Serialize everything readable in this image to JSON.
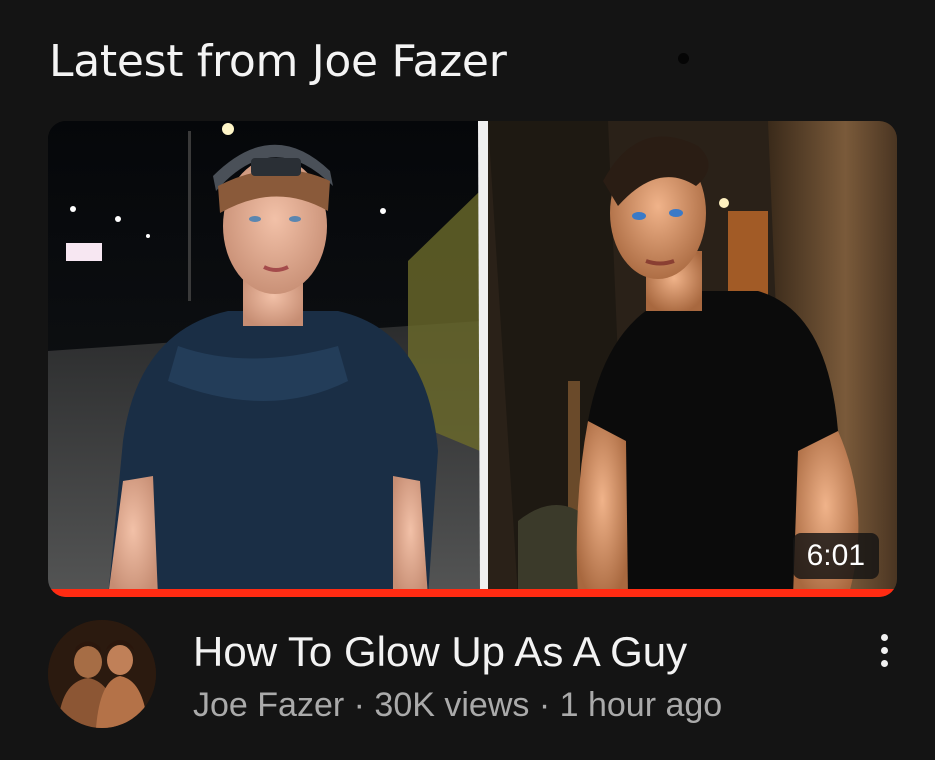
{
  "shelf": {
    "title": "Latest from Joe Fazer"
  },
  "video": {
    "duration": "6:01",
    "title": "How To Glow Up As A Guy",
    "channel": "Joe Fazer",
    "separator": "·",
    "views": "30K views",
    "age": "1 hour ago",
    "watch_progress": 1.0
  },
  "icons": {
    "more": "more-vert-icon"
  },
  "colors": {
    "background": "#141414",
    "progress": "#ff2b12",
    "title": "#f3f3f3",
    "subtext": "#aaaaaa"
  }
}
